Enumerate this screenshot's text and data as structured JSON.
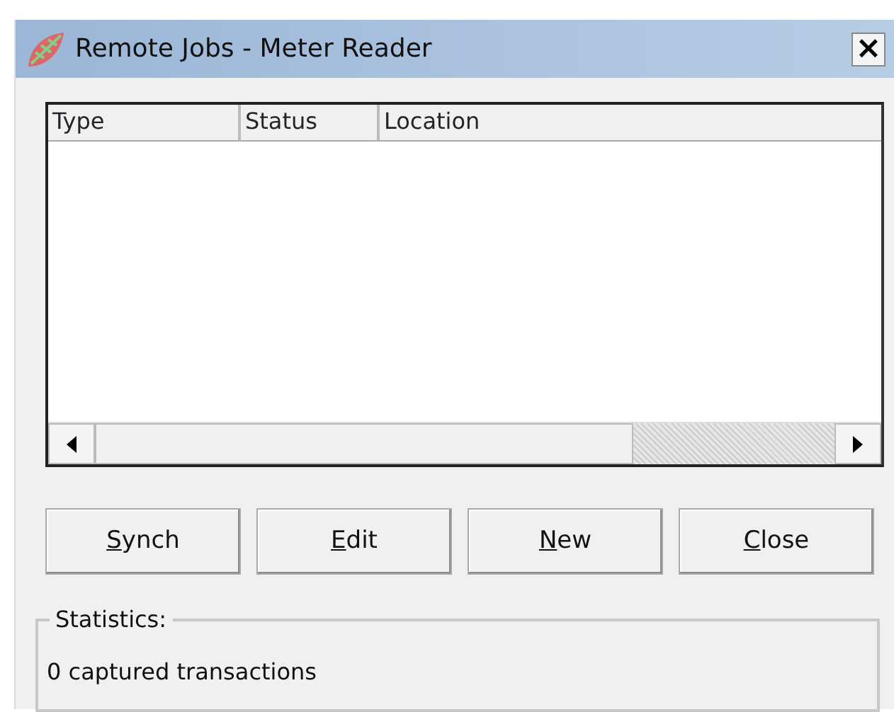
{
  "window": {
    "title": "Remote Jobs - Meter Reader",
    "close_glyph": "×"
  },
  "table": {
    "columns": [
      "Type",
      "Status",
      "Location"
    ]
  },
  "buttons": [
    {
      "label": "Synch",
      "mnemonic_underlined": true
    },
    {
      "label": "Edit",
      "mnemonic_underlined": true
    },
    {
      "label": "New",
      "mnemonic_underlined": true
    },
    {
      "label": "Close",
      "mnemonic_underlined": true
    }
  ],
  "statistics": {
    "legend": "Statistics:",
    "text": "0 captured transactions"
  }
}
